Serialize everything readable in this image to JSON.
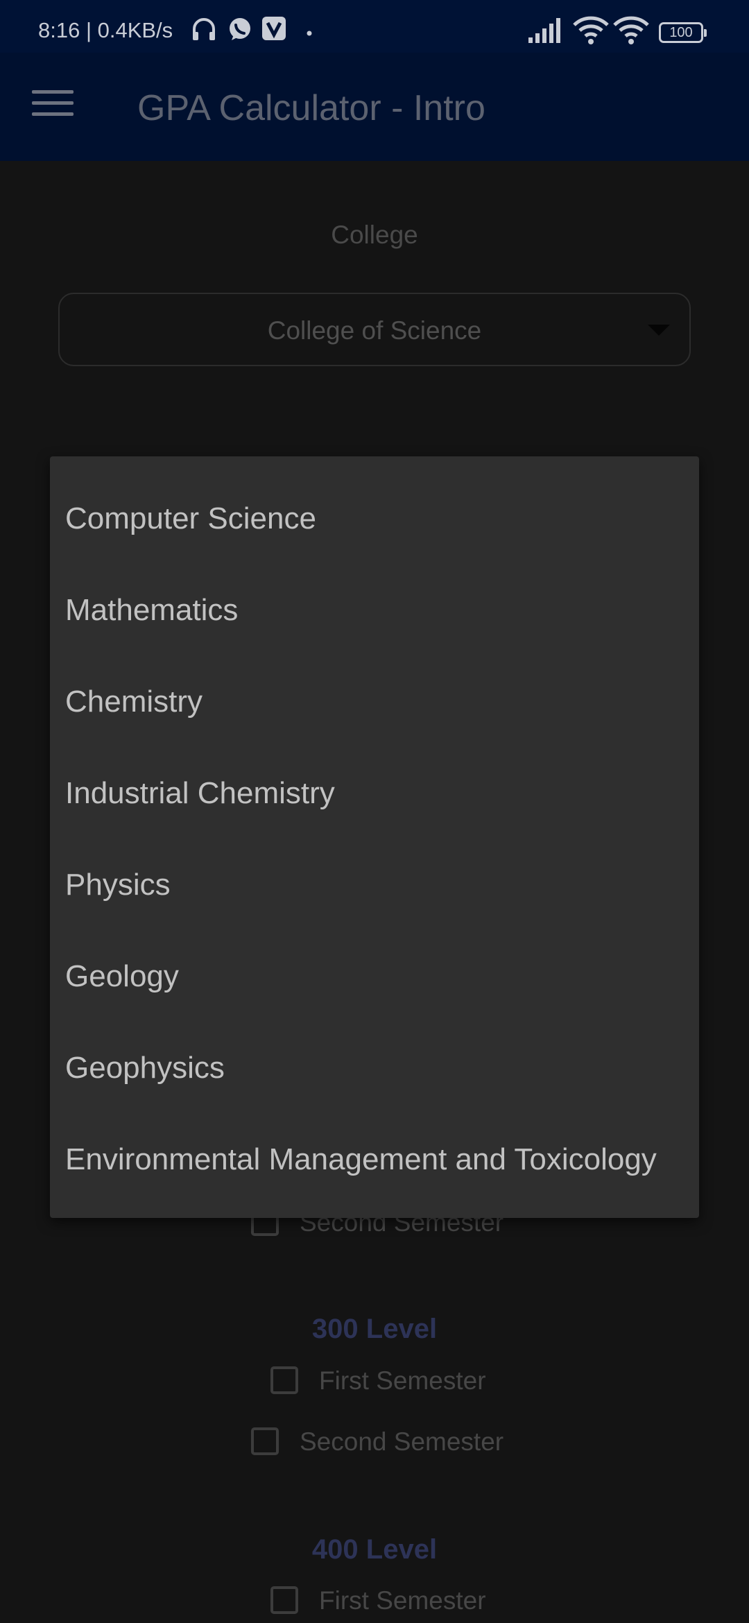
{
  "status_bar": {
    "time_speed": "8:16 | 0.4KB/s",
    "battery": "100",
    "icons": [
      "headphones-icon",
      "whatsapp-icon",
      "v-app-icon",
      "dot-icon",
      "signal-icon",
      "wifi-icon",
      "wifi-icon",
      "battery-icon"
    ]
  },
  "app_bar": {
    "title": "GPA Calculator - Intro",
    "menu_icon": "hamburger-menu-icon"
  },
  "college": {
    "label": "College",
    "selected": "College of Science"
  },
  "departments": [
    "Computer Science",
    "Mathematics",
    "Chemistry",
    "Industrial Chemistry",
    "Physics",
    "Geology",
    "Geophysics",
    "Environmental Management and Toxicology"
  ],
  "levels": {
    "behind_second": "Second Semester",
    "l300": {
      "title": "300 Level",
      "first": "First Semester",
      "second": "Second Semester"
    },
    "l400": {
      "title": "400 Level",
      "first": "First Semester"
    }
  },
  "colors": {
    "status_bar": "#001235",
    "app_bar": "#00102f",
    "background": "#141414",
    "dropdown": "#2f2f2f",
    "level_title": "#2d3357"
  }
}
